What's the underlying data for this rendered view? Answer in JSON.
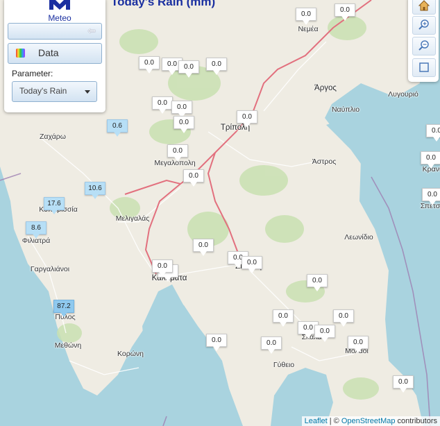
{
  "header": {
    "title": "Today's Rain (mm)"
  },
  "logo": {
    "text": "Meteo"
  },
  "panel": {
    "data_button": "Data",
    "parameter_label": "Parameter:",
    "parameter_value": "Today's Rain"
  },
  "toolbar": {
    "icons": [
      "home-icon",
      "zoom-in-icon",
      "zoom-out-icon",
      "fullscreen-icon"
    ]
  },
  "attribution": {
    "leaflet": "Leaflet",
    "separator": " | © ",
    "osm": "OpenStreetMap",
    "suffix": " contributors"
  },
  "places": [
    {
      "name": "Νεμέα"
    },
    {
      "name": "Άργος"
    },
    {
      "name": "Ναύπλιο"
    },
    {
      "name": "Λυγουριό"
    },
    {
      "name": "Τρίπολη"
    },
    {
      "name": "Άστρος"
    },
    {
      "name": "Κρανί"
    },
    {
      "name": "Σπέτσ"
    },
    {
      "name": "Ζαχάρω"
    },
    {
      "name": "Μεγαλόπολη"
    },
    {
      "name": "Κυπαρισσία"
    },
    {
      "name": "Μελιγαλάς"
    },
    {
      "name": "Φιλιατρά"
    },
    {
      "name": "Γαργαλιάνοι"
    },
    {
      "name": "Καλαμάτα"
    },
    {
      "name": "Σπάρτη"
    },
    {
      "name": "Λεωνίδιο"
    },
    {
      "name": "Πύλος"
    },
    {
      "name": "Μεθώνη"
    },
    {
      "name": "Κορώνη"
    },
    {
      "name": "Σκάλα"
    },
    {
      "name": "Γύθειο"
    },
    {
      "name": "Μολάοι"
    }
  ],
  "markers": [
    {
      "value": "0.0"
    },
    {
      "value": "0.0"
    },
    {
      "value": "0.0"
    },
    {
      "value": "0.0"
    },
    {
      "value": "0.0"
    },
    {
      "value": "0.0"
    },
    {
      "value": "0.0"
    },
    {
      "value": "0.0"
    },
    {
      "value": "0.0"
    },
    {
      "value": "0.0"
    },
    {
      "value": "0.6"
    },
    {
      "value": "0.0"
    },
    {
      "value": "0.0"
    },
    {
      "value": "0.0"
    },
    {
      "value": "0.0"
    },
    {
      "value": "10.6"
    },
    {
      "value": "17.6"
    },
    {
      "value": "8.6"
    },
    {
      "value": "0.0"
    },
    {
      "value": "0.0"
    },
    {
      "value": "0.0"
    },
    {
      "value": "0.0"
    },
    {
      "value": "0.0"
    },
    {
      "value": "0.0"
    },
    {
      "value": "87.2"
    },
    {
      "value": "0.0"
    },
    {
      "value": "0.0"
    },
    {
      "value": "0.0"
    },
    {
      "value": "0.0"
    },
    {
      "value": "0.0"
    },
    {
      "value": "0.0"
    },
    {
      "value": "0.0"
    },
    {
      "value": "0.0"
    },
    {
      "value": "0.0"
    }
  ],
  "colors": {
    "sea": "#a9d3df",
    "land": "#efece3",
    "forest": "#c8e0b0",
    "main_road": "#e2707e",
    "marker_blue": "#b7dff6",
    "title": "#1a2fa0"
  }
}
